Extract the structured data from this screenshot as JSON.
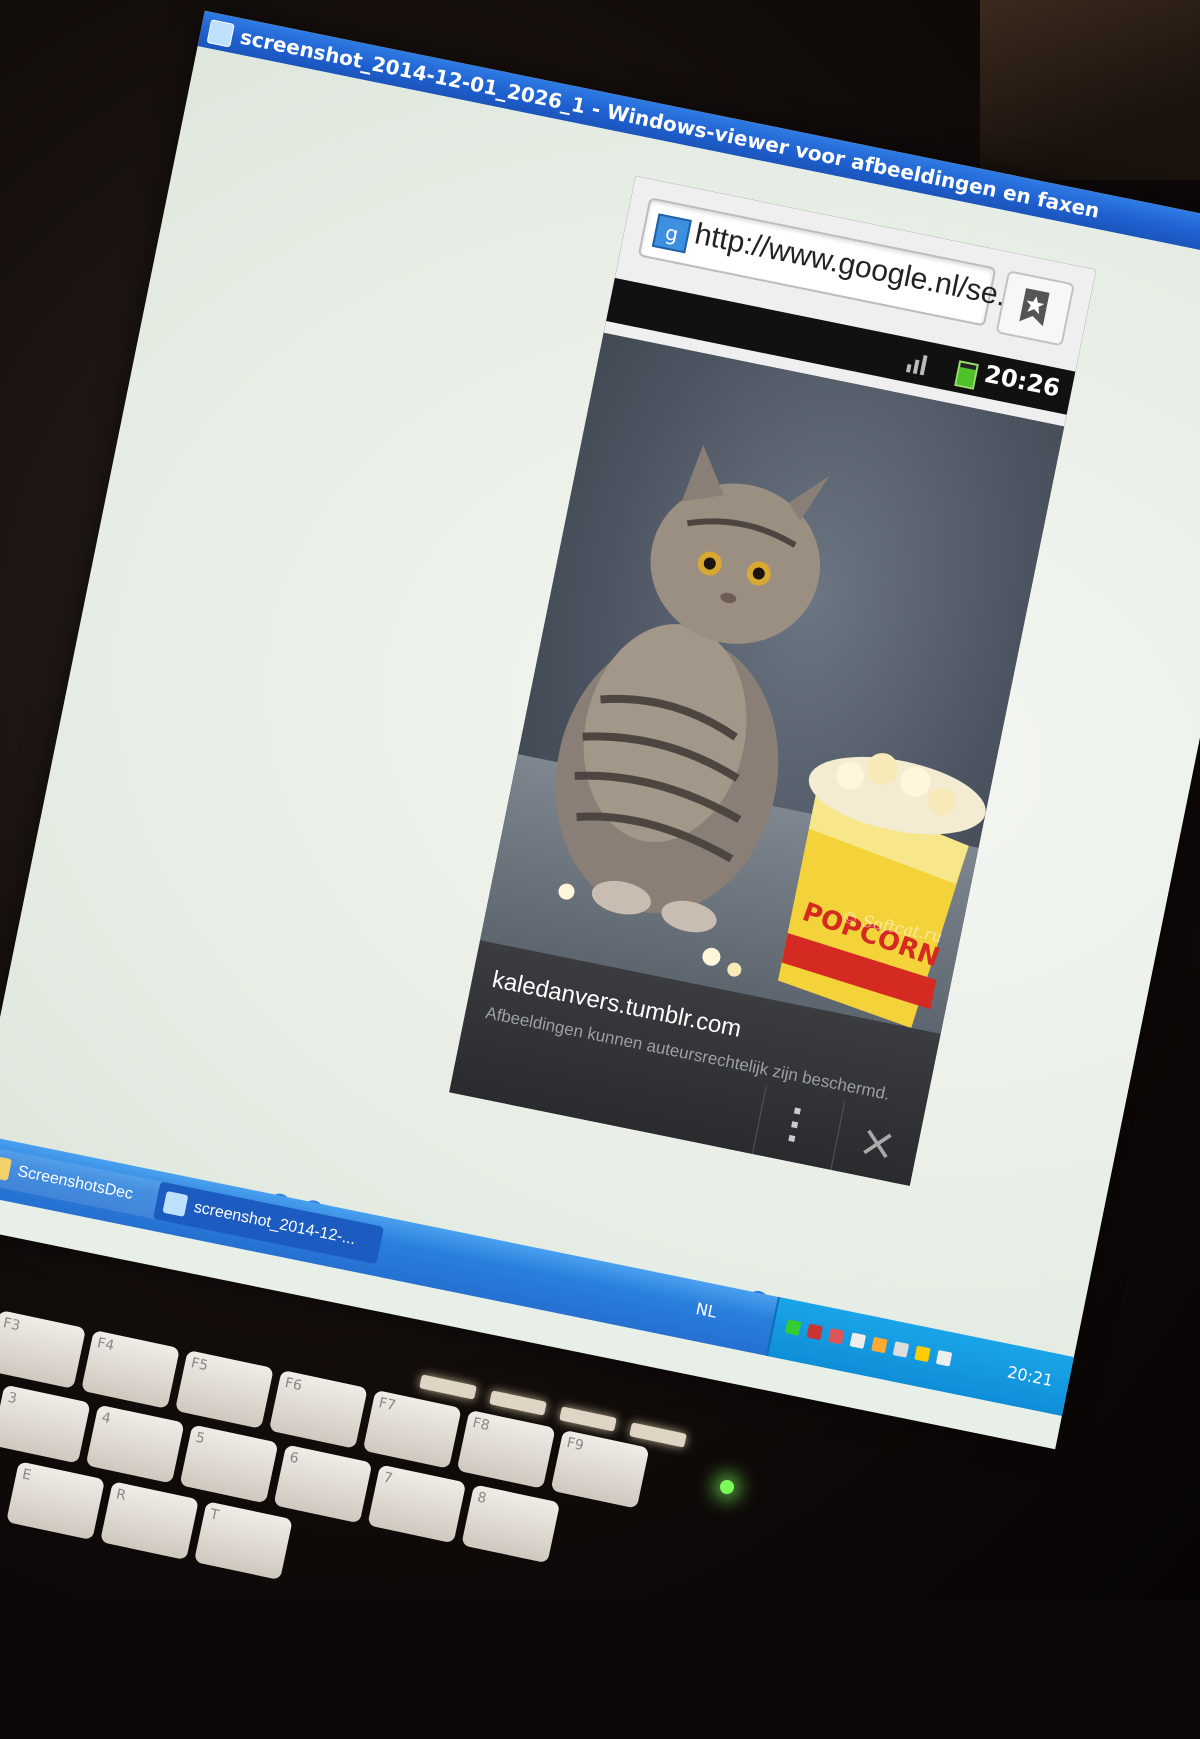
{
  "window": {
    "title": "screenshot_2014-12-01_2026_1 - Windows-viewer voor afbeeldingen en faxen"
  },
  "phone": {
    "status_time": "20:26",
    "url": "http://www.google.nl/se...",
    "source_domain": "kaledanvers.tumblr.com",
    "copyright_note": "Afbeeldingen kunnen auteursrechtelijk zijn beschermd.",
    "watermark": "© Softcat.ru",
    "close_glyph": "×",
    "popcorn_label": "POPCORN"
  },
  "taskbar": {
    "buttons": [
      {
        "label": "ScreenshotsDec"
      },
      {
        "label": "screenshot_2014-12-..."
      }
    ],
    "language": "NL",
    "clock": "20:21"
  },
  "colors": {
    "titlebar": "#1e5fcf",
    "taskbar": "#2a7fdc",
    "tray": "#0f8ed8",
    "popcorn_yellow": "#f3d23a",
    "popcorn_red": "#d42a22"
  },
  "keyboard": {
    "keys": [
      "F3",
      "F4",
      "F5",
      "F6",
      "F7",
      "F8",
      "F9",
      "3",
      "4",
      "5",
      "6",
      "7",
      "8",
      "E",
      "R",
      "T"
    ]
  }
}
